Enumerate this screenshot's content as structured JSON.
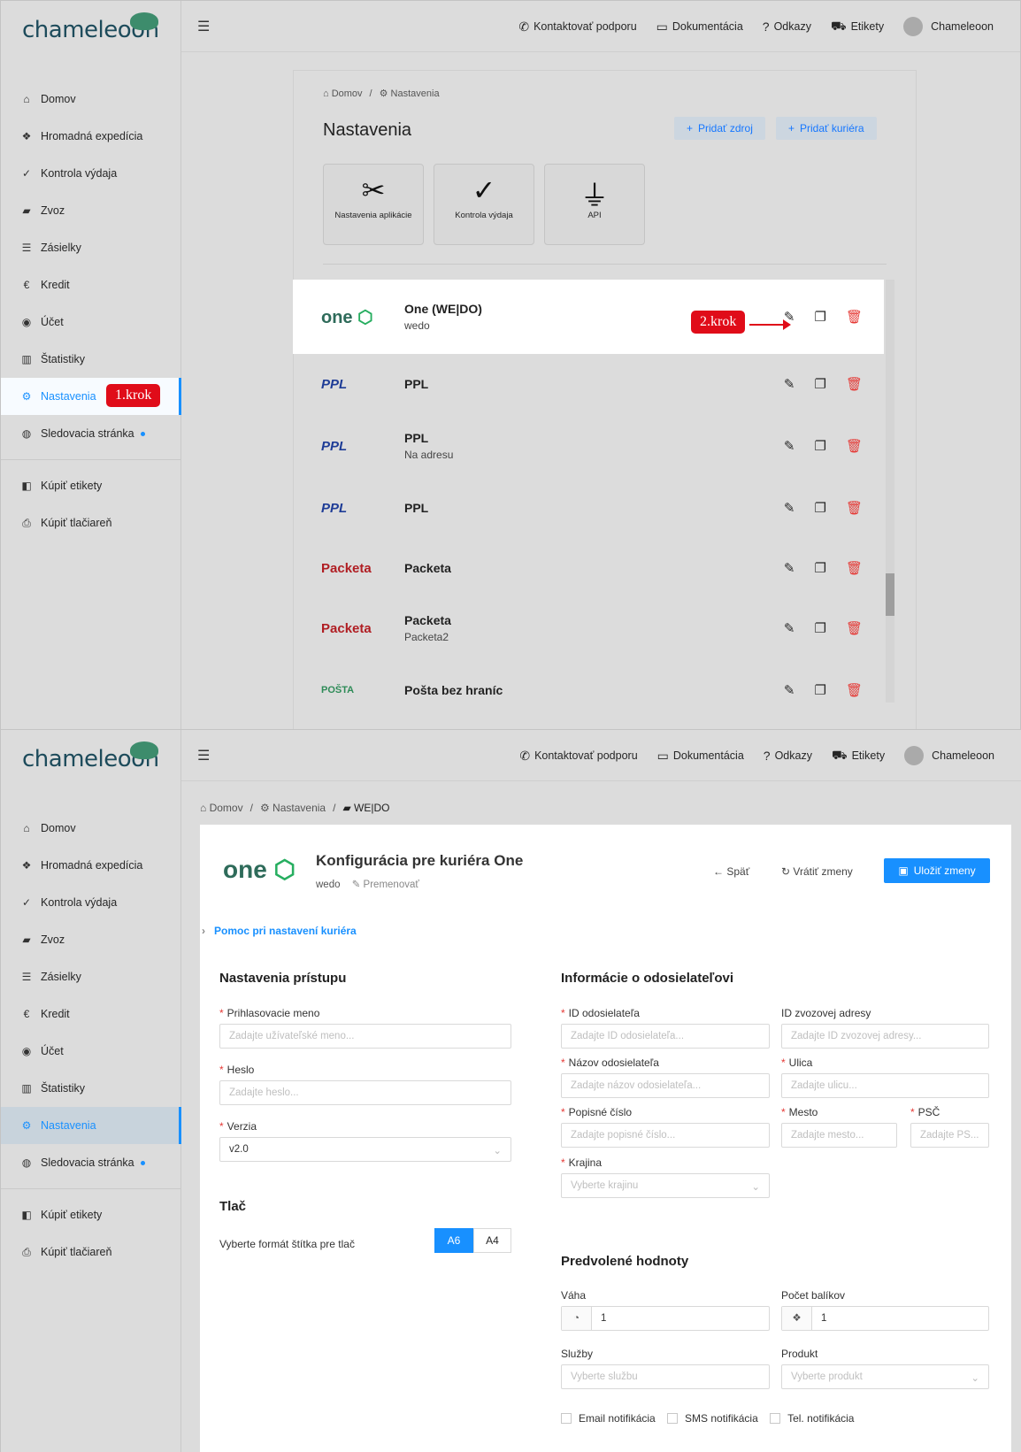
{
  "brand": "chameleon",
  "nav": [
    "Domov",
    "Hromadná expedícia",
    "Kontrola výdaja",
    "Zvoz",
    "Zásielky",
    "Kredit",
    "Účet",
    "Štatistiky",
    "Nastavenia",
    "Sledovacia stránka",
    "Kúpiť etikety",
    "Kúpiť tlačiareň"
  ],
  "top": {
    "support": "Kontaktovať podporu",
    "docs": "Dokumentácia",
    "links": "Odkazy",
    "labels": "Etikety",
    "user": "Chameleoon"
  },
  "s1": {
    "crumb1": "Domov",
    "crumb2": "Nastavenia",
    "title": "Nastavenia",
    "add_source": "Pridať zdroj",
    "add_courier": "Pridať kuriéra",
    "tiles": [
      "Nastavenia aplikácie",
      "Kontrola výdaja",
      "API"
    ],
    "couriers": [
      {
        "logo": "one",
        "name": "One (WE|DO)",
        "sub": "wedo"
      },
      {
        "logo": "PPL",
        "name": "PPL",
        "sub": ""
      },
      {
        "logo": "PPL",
        "name": "PPL",
        "sub": "Na adresu"
      },
      {
        "logo": "PPL",
        "name": "PPL",
        "sub": ""
      },
      {
        "logo": "Packeta",
        "name": "Packeta",
        "sub": ""
      },
      {
        "logo": "Packeta",
        "name": "Packeta",
        "sub": "Packeta2"
      },
      {
        "logo": "POŠTA",
        "name": "Pošta bez hraníc",
        "sub": ""
      }
    ],
    "step1": "1.krok",
    "step2": "2.krok"
  },
  "s2": {
    "crumb1": "Domov",
    "crumb2": "Nastavenia",
    "crumb3": "WE|DO",
    "logo": "one",
    "title": "Konfigurácia pre kuriéra One",
    "sub": "wedo",
    "rename": "Premenovať",
    "back": "Späť",
    "revert": "Vrátiť zmeny",
    "save": "Uložiť zmeny",
    "help": "Pomoc pri nastavení kuriéra",
    "access_title": "Nastavenia prístupu",
    "login_label": "Prihlasovacie meno",
    "login_ph": "Zadajte užívateľské meno...",
    "pass_label": "Heslo",
    "pass_ph": "Zadajte heslo...",
    "ver_label": "Verzia",
    "ver_val": "v2.0",
    "print_title": "Tlač",
    "print_label": "Vyberte formát štítka pre tlač",
    "a6": "A6",
    "a4": "A4",
    "sender_title": "Informácie o odosielateľovi",
    "sid_label": "ID odosielateľa",
    "sid_ph": "Zadajte ID odosielateľa...",
    "pickup_label": "ID zvozovej adresy",
    "pickup_ph": "Zadajte ID zvozovej adresy...",
    "sname_label": "Názov odosielateľa",
    "sname_ph": "Zadajte názov odosielateľa...",
    "street_label": "Ulica",
    "street_ph": "Zadajte ulicu...",
    "num_label": "Popisné číslo",
    "num_ph": "Zadajte popisné číslo...",
    "city_label": "Mesto",
    "city_ph": "Zadajte mesto...",
    "zip_label": "PSČ",
    "zip_ph": "Zadajte PS...",
    "country_label": "Krajina",
    "country_ph": "Vyberte krajinu",
    "defaults_title": "Predvolené hodnoty",
    "weight_label": "Váha",
    "weight_val": "1",
    "count_label": "Počet balíkov",
    "count_val": "1",
    "services_label": "Služby",
    "services_ph": "Vyberte službu",
    "product_label": "Produkt",
    "product_ph": "Vyberte produkt",
    "email_n": "Email notifikácia",
    "sms_n": "SMS notifikácia",
    "tel_n": "Tel. notifikácia"
  },
  "colors": {
    "accent": "#1890ff",
    "danger": "#e53935",
    "step": "#e00c19",
    "one_green": "#27ae60"
  }
}
